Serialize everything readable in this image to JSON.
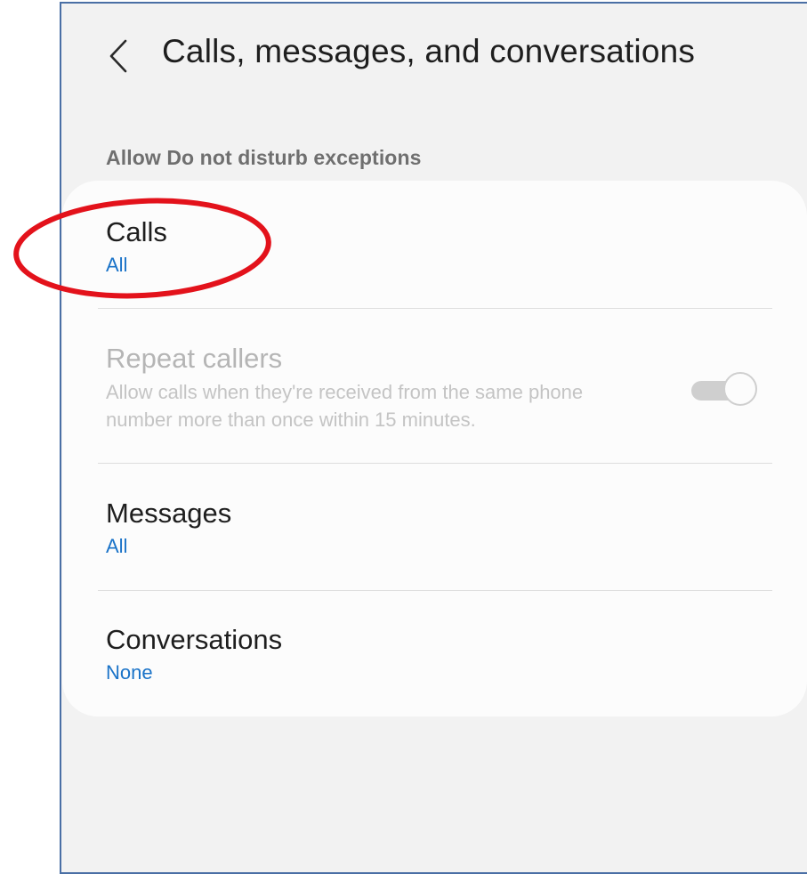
{
  "header": {
    "title": "Calls, messages, and conversations",
    "back_icon": "chevron-left-icon"
  },
  "section": {
    "header": "Allow Do not disturb exceptions"
  },
  "settings": {
    "calls": {
      "title": "Calls",
      "value": "All"
    },
    "repeat_callers": {
      "title": "Repeat callers",
      "description": "Allow calls when they're received from the same phone number more than once within 15 minutes.",
      "enabled": false,
      "toggle_on": true
    },
    "messages": {
      "title": "Messages",
      "value": "All"
    },
    "conversations": {
      "title": "Conversations",
      "value": "None"
    }
  },
  "colors": {
    "accent": "#1a73c8",
    "annotation": "#e3121b",
    "frame_border": "#4a6fa5"
  }
}
